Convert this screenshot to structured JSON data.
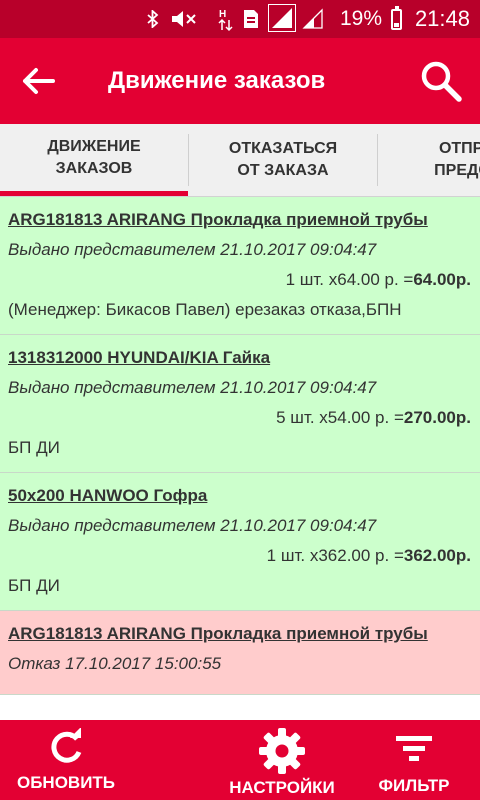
{
  "status_bar": {
    "battery_percent": "19%",
    "time": "21:48",
    "icons": [
      "bluetooth-icon",
      "mute-icon",
      "sim-icon",
      "sd-card-icon",
      "signal-icon",
      "signal-icon",
      "battery-icon"
    ]
  },
  "app_bar": {
    "title": "Движение заказов",
    "back_icon": "arrow-left-icon",
    "search_icon": "search-icon"
  },
  "tabs": [
    {
      "label": "ДВИЖЕНИЕ ЗАКАЗОВ",
      "active": true
    },
    {
      "label": "ОТКАЗАТЬСЯ ОТ ЗАКАЗА",
      "active": false
    },
    {
      "label": "ОТПРАВ ПРЕДСТА",
      "active": false
    }
  ],
  "orders": [
    {
      "title": "ARG181813 ARIRANG Прокладка приемной трубы",
      "status": "Выдано представителем  21.10.2017 09:04:47",
      "qty_price": "1 шт. x64.00 р. =",
      "total": "64.00р.",
      "note": "(Менеджер: Бикасов Павел) ерезаказ отказа,БПН",
      "color": "#ccffcc"
    },
    {
      "title": "1318312000 HYUNDAI/KIA Гайка",
      "status": "Выдано представителем  21.10.2017 09:04:47",
      "qty_price": "5 шт. x54.00 р. =",
      "total": "270.00р.",
      "note": "БП ДИ",
      "color": "#ccffcc"
    },
    {
      "title": "50х200 HANWOO Гофра",
      "status": "Выдано представителем  21.10.2017 09:04:47",
      "qty_price": "1 шт. x362.00 р. =",
      "total": "362.00р.",
      "note": "БП ДИ",
      "color": "#ccffcc"
    },
    {
      "title": "ARG181813 ARIRANG Прокладка приемной трубы",
      "status": "Отказ  17.10.2017 15:00:55",
      "color": "#ffcccc"
    }
  ],
  "bottom_bar": {
    "refresh": {
      "label": "ОБНОВИТЬ",
      "icon": "refresh-icon"
    },
    "settings": {
      "label": "НАСТРОЙКИ",
      "icon": "gear-icon"
    },
    "filter": {
      "label": "ФИЛЬТР",
      "icon": "filter-icon"
    }
  },
  "colors": {
    "accent": "#e30033",
    "status_bar": "#b8002a",
    "delivered_bg": "#ccffcc",
    "refused_bg": "#ffcccc"
  }
}
